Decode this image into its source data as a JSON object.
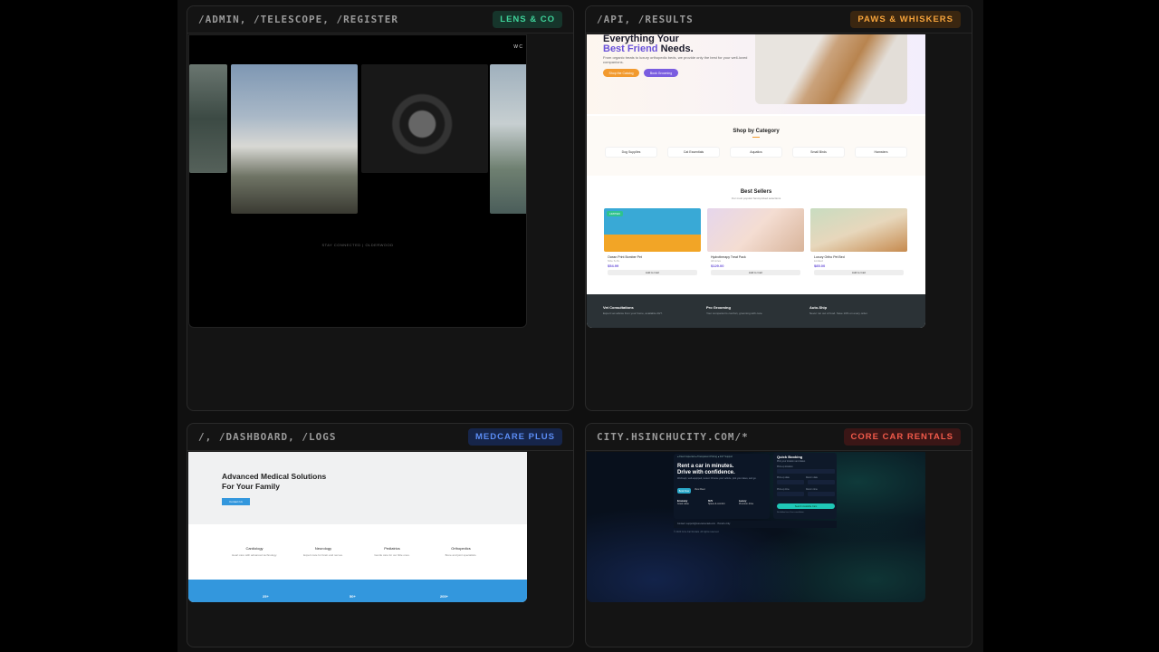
{
  "cards": [
    {
      "route": "/ADMIN, /TELESCOPE, /REGISTER",
      "tag": "LENS & CO",
      "tag_color": "#3fd39a",
      "site": {
        "corner_text": "W C",
        "footer_text": "STAY CONNECTED | OLDERWOOD"
      }
    },
    {
      "route": "/API, /RESULTS",
      "tag": "PAWS & WHISKERS",
      "tag_color": "#f5a33b",
      "site": {
        "hero_line1": "Everything Your",
        "hero_highlight": "Best Friend",
        "hero_line2_rest": " Needs.",
        "hero_sub": "From organic treats to luxury orthopedic beds, we provide only the best for your well-loved companions.",
        "btn_primary": "Shop the Catalog",
        "btn_secondary": "Book Grooming",
        "category_title": "Shop by Category",
        "categories": [
          "Dog Supplies",
          "Cat Essentials",
          "Aquatics",
          "Small Birds",
          "Hamsters"
        ],
        "best_title": "Best Sellers",
        "best_sub": "Our most popular hand-picked selections",
        "products": [
          {
            "badge": "LIMITED",
            "name": "Ocean Print Bomber Pet",
            "mini": "Size S-XL",
            "price": "$54.99",
            "cta": "Add to Cart"
          },
          {
            "badge": "",
            "name": "Hydrotherapy Treat Pack",
            "mini": "All sizes",
            "price": "$129.00",
            "cta": "Add to Cart"
          },
          {
            "badge": "",
            "name": "Luxury Ortho Pet Bed",
            "mini": "Limited",
            "price": "$85.00",
            "cta": "Add to Cart"
          }
        ],
        "footer": [
          {
            "title": "Vet Consultations",
            "desc": "Expert vet advice from your home, available 24/7."
          },
          {
            "title": "Pro Grooming",
            "desc": "Your companion's comfort, grooming with care."
          },
          {
            "title": "Auto-Ship",
            "desc": "Never run out of food. Save 10% on every order."
          }
        ]
      }
    },
    {
      "route": "/, /DASHBOARD, /LOGS",
      "tag": "MEDCARE PLUS",
      "tag_color": "#5b8df5",
      "site": {
        "hero_line1": "Advanced Medical Solutions",
        "hero_line2": "For Your Family",
        "btn": "Contact Us",
        "services": [
          {
            "title": "Cardiology",
            "desc": "Heart care with advanced technology."
          },
          {
            "title": "Neurology",
            "desc": "Expert care for brain and nerves."
          },
          {
            "title": "Pediatrics",
            "desc": "Gentle care for our little ones."
          },
          {
            "title": "Orthopedics",
            "desc": "Bone and joint specialists."
          }
        ],
        "stats": [
          "25+",
          "50+",
          "200+"
        ]
      }
    },
    {
      "route": "CITY.HSINCHUCITY.COM/*",
      "tag": "CORE CAR RENTALS",
      "tag_color": "#f25a4a",
      "site": {
        "pills": "● Fleet Inspected   ● Transparent Pricing   ● 24/7 Support",
        "hero_line1": "Rent a car in minutes.",
        "hero_line2": "Drive with confidence.",
        "hero_sub": "Well-kept, well-equipped, tested. Choose your vehicle, pick your dates, and go.",
        "btn_primary": "Book Now",
        "btn_secondary": "View Fleet",
        "tiers": [
          {
            "name": "Economy",
            "desc": "Great value"
          },
          {
            "name": "SUV",
            "desc": "Space & comfort"
          },
          {
            "name": "Luxury",
            "desc": "Premium drive"
          }
        ],
        "quick_title": "Quick Booking",
        "quick_sub": "Pick your location and dates",
        "fields": [
          "Pick-up location",
          "Pick-up date",
          "Return date",
          "Pick-up time",
          "Return time"
        ],
        "search_btn": "Search Available Cars",
        "note": "No hidden fees. Free cancellation.",
        "contact": "Contact: support@corecarrentals.com · Hsinchu City",
        "copyright": "© 2024 Core Car Rentals. All rights reserved."
      }
    }
  ]
}
